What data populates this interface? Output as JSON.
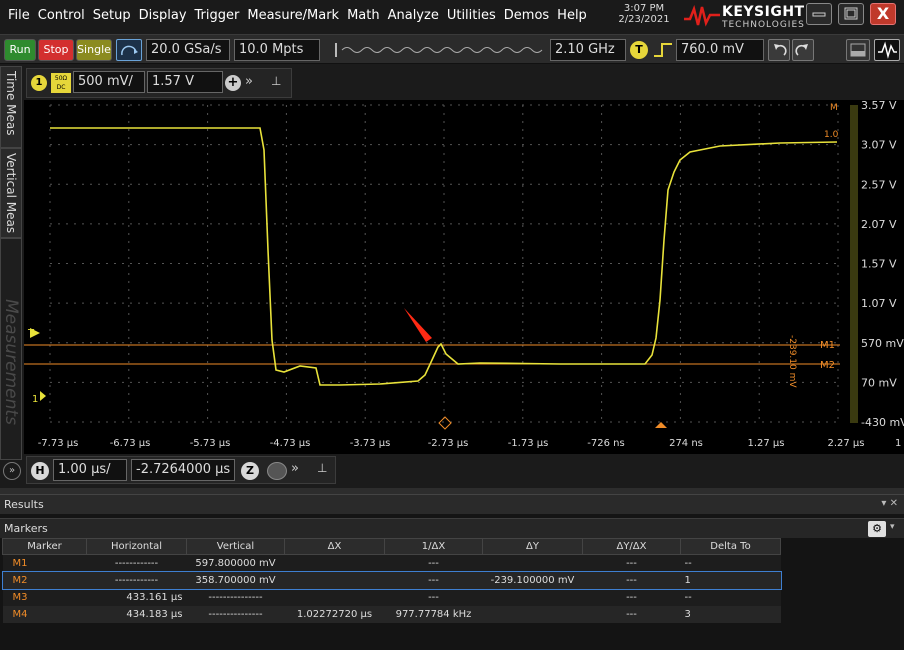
{
  "menu": [
    "File",
    "Control",
    "Setup",
    "Display",
    "Trigger",
    "Measure/Mark",
    "Math",
    "Analyze",
    "Utilities",
    "Demos",
    "Help"
  ],
  "clock": {
    "time": "3:07 PM",
    "date": "2/23/2021"
  },
  "brand": {
    "name": "KEYSIGHT",
    "sub": "TECHNOLOGIES"
  },
  "window": {
    "close_label": "X"
  },
  "toolbar": {
    "run_label": "Run",
    "stop_label": "Stop",
    "single_label": "Single",
    "sample_rate": "20.0 GSa/s",
    "memory_depth": "10.0 Mpts",
    "bandwidth": "2.10 GHz",
    "trigger_badge": "T",
    "trigger_level": "760.0 mV"
  },
  "side_tabs": {
    "time": "Time Meas",
    "vertical": "Vertical Meas",
    "measurements": "Measurements",
    "expand": "»"
  },
  "channel": {
    "number": "1",
    "impedance_top": "50Ω",
    "impedance_bottom": "DC",
    "scale": "500 mV/",
    "offset": "1.57 V",
    "add": "+",
    "more": "»",
    "pin": "⊥"
  },
  "plot": {
    "colors": {
      "trace": "#e8e23a",
      "marker": "#f08c28",
      "grid": "#555555",
      "axis_text": "#dcdcdc"
    },
    "y_labels": [
      "3.57 V",
      "3.07 V",
      "2.57 V",
      "2.07 V",
      "1.57 V",
      "1.07 V",
      "570 mV",
      "70 mV",
      "-430 mV"
    ],
    "x_labels": [
      "-7.73 µs",
      "-6.73 µs",
      "-5.73 µs",
      "-4.73 µs",
      "-3.73 µs",
      "-2.73 µs",
      "-1.73 µs",
      "-726 ns",
      "274 ns",
      "1.27 µs",
      "2.27 µs"
    ],
    "x_extra": "1",
    "marker_labels": {
      "m1": "M1",
      "m2": "M2",
      "delta": "-239.10 mV",
      "scale_top": "M",
      "scale_value": "1.0"
    },
    "trigger_marker": "T",
    "ground_marker": "1"
  },
  "horizontal": {
    "badge": "H",
    "scale": "1.00 µs/",
    "position": "-2.7264000 µs",
    "zoom": "Z",
    "more": "»",
    "pin": "⊥"
  },
  "results": {
    "title": "Results",
    "controls": "▾ ✕"
  },
  "markers": {
    "title": "Markers",
    "gear": "⚙",
    "caret": "▾",
    "columns": [
      "Marker",
      "Horizontal",
      "Vertical",
      "ΔX",
      "1/ΔX",
      "ΔY",
      "ΔY/ΔX",
      "Delta To"
    ],
    "rows": [
      {
        "name": "M1",
        "horizontal": "------------",
        "vertical": "597.800000 mV",
        "dx": "",
        "inv_dx": "---",
        "dy": "",
        "dydx": "---",
        "delta_to": "--"
      },
      {
        "name": "M2",
        "horizontal": "------------",
        "vertical": "358.700000 mV",
        "dx": "",
        "inv_dx": "---",
        "dy": "-239.100000 mV",
        "dydx": "---",
        "delta_to": "1"
      },
      {
        "name": "M3",
        "horizontal": "433.161 µs",
        "vertical": "---------------",
        "dx": "",
        "inv_dx": "---",
        "dy": "",
        "dydx": "---",
        "delta_to": "--"
      },
      {
        "name": "M4",
        "horizontal": "434.183 µs",
        "vertical": "---------------",
        "dx": "1.02272720 µs",
        "inv_dx": "977.77784 kHz",
        "dy": "",
        "dydx": "---",
        "delta_to": "3"
      }
    ]
  }
}
